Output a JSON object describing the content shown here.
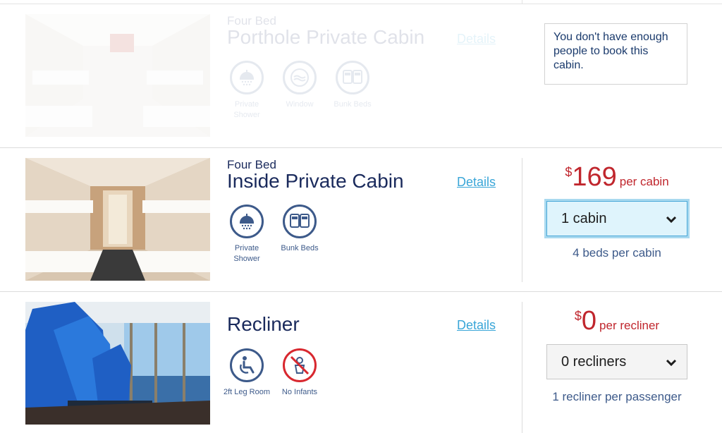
{
  "rows": [
    {
      "subtitle": "Four Bed",
      "title": "Porthole Private Cabin",
      "details_label": "Details",
      "amenities": [
        {
          "icon": "shower-icon",
          "label": "Private Shower"
        },
        {
          "icon": "window-icon",
          "label": "Window"
        },
        {
          "icon": "bunk-beds-icon",
          "label": "Bunk Beds"
        }
      ],
      "availability_message": "You don't have enough people to book this cabin.",
      "disabled": true
    },
    {
      "subtitle": "Four Bed",
      "title": "Inside Private Cabin",
      "details_label": "Details",
      "amenities": [
        {
          "icon": "shower-icon",
          "label": "Private Shower"
        },
        {
          "icon": "bunk-beds-icon",
          "label": "Bunk Beds"
        }
      ],
      "price": {
        "currency": "$",
        "amount": "169",
        "unit": "per cabin"
      },
      "selector": {
        "value": "1 cabin",
        "focused": true
      },
      "note": "4 beds per cabin"
    },
    {
      "title": "Recliner",
      "details_label": "Details",
      "amenities": [
        {
          "icon": "wheelchair-legroom-icon",
          "label": "2ft Leg Room"
        },
        {
          "icon": "no-infants-icon",
          "label": "No Infants"
        }
      ],
      "price": {
        "currency": "$",
        "amount": "0",
        "unit": "per recliner"
      },
      "selector": {
        "value": "0 recliners",
        "focused": false
      },
      "note": "1 recliner per passenger"
    }
  ],
  "colors": {
    "navy": "#1a2a5c",
    "price_red": "#c0262d",
    "link_blue": "#3aa6d8",
    "focus_bg": "#dff4fc",
    "icon_blue": "#3d5a8a",
    "no_infant_red": "#d8282f"
  }
}
